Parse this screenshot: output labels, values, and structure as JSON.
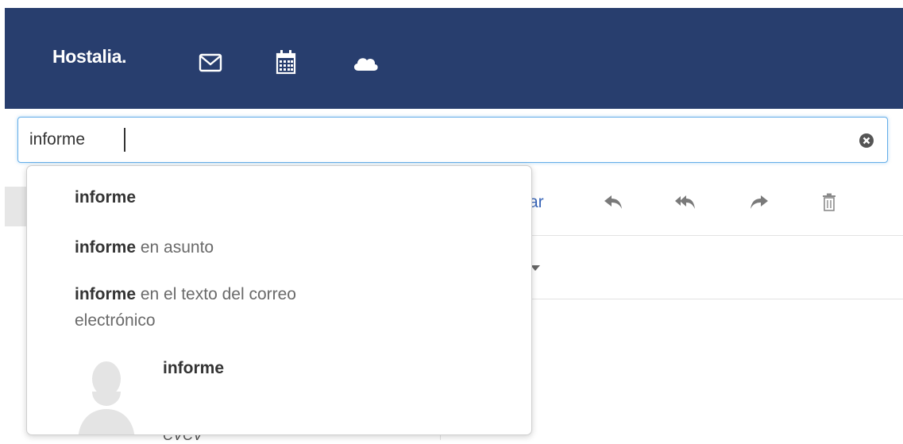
{
  "header": {
    "brand": "Hostalia.",
    "icons": [
      "mail-icon",
      "calendar-icon",
      "cloud-icon"
    ],
    "background_color": "#283e6e"
  },
  "search": {
    "value": "informe",
    "clear_icon": "clear-circle-icon"
  },
  "toolbar": {
    "partial_label": "ar",
    "icons": [
      "reply-icon",
      "reply-all-icon",
      "forward-icon",
      "trash-icon"
    ],
    "link_color": "#3a66b8"
  },
  "dropdown": {
    "suggestions": [
      {
        "term": "informe",
        "scope": ""
      },
      {
        "term": "informe",
        "scope": " en asunto"
      },
      {
        "term": "informe",
        "scope_line1": " en el texto del correo",
        "scope_line2": "electrónico"
      }
    ],
    "contact": {
      "name": "informe",
      "avatar_icon": "person-silhouette-icon"
    }
  },
  "background": {
    "bottom_text": "CVCV"
  }
}
